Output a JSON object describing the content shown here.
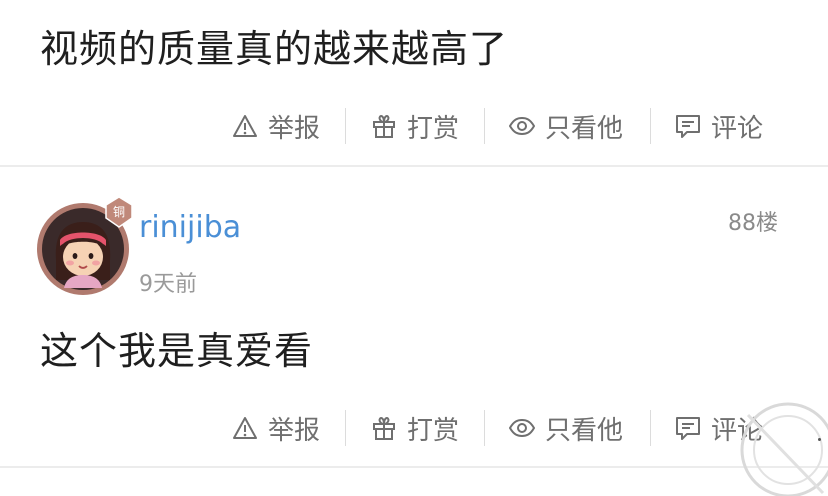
{
  "post1": {
    "text": "视频的质量真的越来越高了"
  },
  "post2": {
    "username": "rinijiba",
    "badge": "铜",
    "time": "9天前",
    "floor": "88楼",
    "text": "这个我是真爱看"
  },
  "actions": {
    "report": "举报",
    "reward": "打赏",
    "only_view": "只看他",
    "comment": "评论"
  },
  "colors": {
    "username": "#4a8fd6",
    "badge": "#c0897a",
    "action_text": "#6f6f6f",
    "divider": "#ececec"
  },
  "icons": [
    "warning-icon",
    "gift-icon",
    "eye-icon",
    "comment-icon"
  ]
}
